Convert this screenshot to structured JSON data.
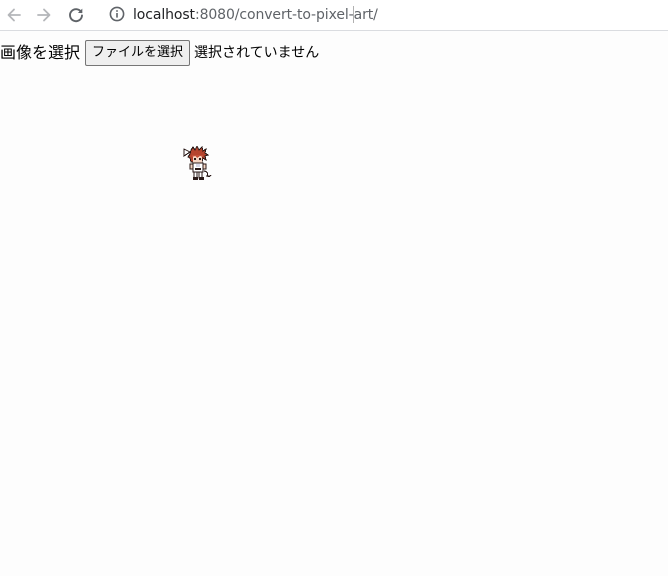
{
  "browser": {
    "url_host": "localhost",
    "url_path": ":8080/convert-to-pixel-art/",
    "icons": {
      "back": "arrow-left-icon",
      "forward": "arrow-right-icon",
      "reload": "reload-icon",
      "site_info": "info-icon"
    }
  },
  "page": {
    "label": "画像を選択",
    "file_button_label": "ファイルを選択",
    "file_status": "選択されていません"
  },
  "colors": {
    "background": "#fdfdfd",
    "sprite_hair": "#b5442e",
    "sprite_outline": "#2a1a18"
  }
}
